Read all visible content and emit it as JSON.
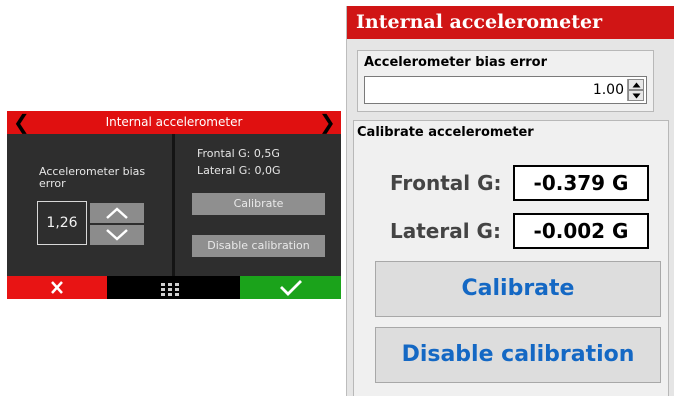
{
  "device": {
    "title": "Internal accelerometer",
    "bias_label": "Accelerometer bias error",
    "bias_value": "1,26",
    "frontal_readout": "Frontal G: 0,5G",
    "lateral_readout": "Lateral G: 0,0G",
    "calibrate_label": "Calibrate",
    "disable_label": "Disable calibration",
    "icons": {
      "prev": "chevron-left-icon",
      "next": "chevron-right-icon",
      "up": "chevron-up-icon",
      "down": "chevron-down-icon",
      "cancel": "close-icon",
      "menu": "grid-menu-icon",
      "confirm": "check-icon"
    },
    "colors": {
      "title_bar": "#e01010",
      "background": "#2e2e2e",
      "cancel": "#e81414",
      "confirm": "#1ba31b",
      "button": "#8f8f8f"
    }
  },
  "dialog": {
    "title": "Internal accelerometer",
    "bias_group_label": "Accelerometer bias error",
    "bias_value": "1.00",
    "calibrate_group_label": "Calibrate accelerometer",
    "frontal_label": "Frontal G:",
    "frontal_value": "-0.379 G",
    "lateral_label": "Lateral G:",
    "lateral_value": "-0.002 G",
    "calibrate_label": "Calibrate",
    "disable_label": "Disable calibration",
    "colors": {
      "title_bar": "#d01515",
      "button_text": "#1468c4"
    }
  }
}
